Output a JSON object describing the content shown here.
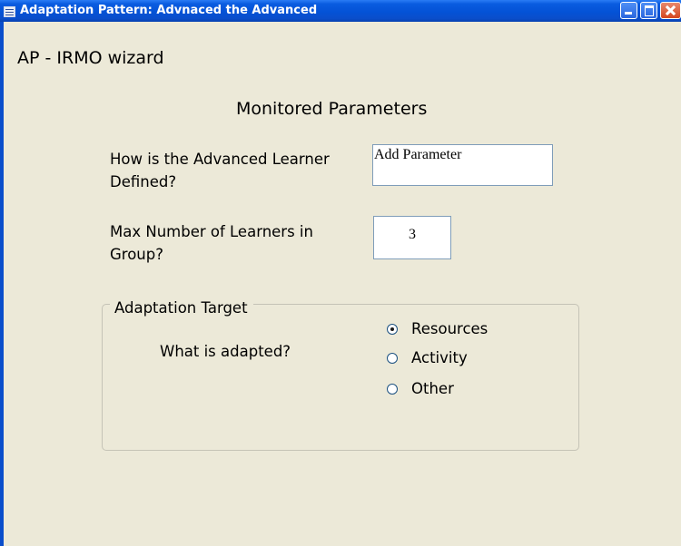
{
  "window": {
    "title": "Adaptation Pattern: Advnaced the Advanced",
    "icon": "form-icon",
    "controls": [
      "minimize-icon",
      "maximize-icon",
      "close-icon"
    ]
  },
  "form": {
    "heading": "AP - IRMO wizard",
    "section_title": "Monitored Parameters",
    "q_advanced_learner": {
      "label": "How is the Advanced Learner  Defined?",
      "value": "Add Parameter"
    },
    "q_max_learners": {
      "label": "Max Number of Learners in Group?",
      "value": "3"
    },
    "adaptation_target": {
      "group_title": "Adaptation Target",
      "question": "What is adapted?",
      "options": [
        {
          "label": "Resources",
          "selected": true
        },
        {
          "label": "Activity",
          "selected": false
        },
        {
          "label": "Other",
          "selected": false
        }
      ]
    }
  },
  "colors": {
    "titlebar": "#0452D6",
    "window_bg": "#ECE9D8",
    "input_border": "#7F9DB9"
  }
}
